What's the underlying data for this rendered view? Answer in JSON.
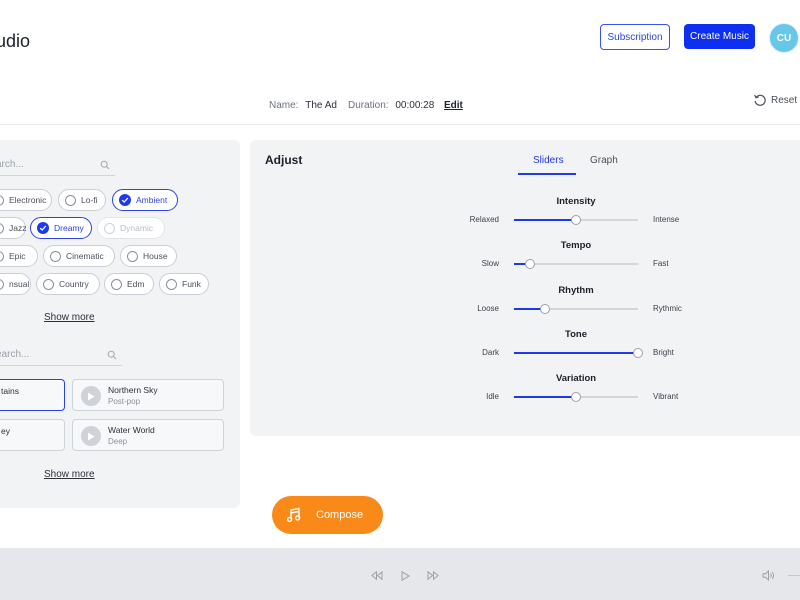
{
  "header": {
    "app_title": "udio",
    "subscription_label": "Subscription",
    "create_music_label": "Create Music",
    "avatar_initials": "CU"
  },
  "track_meta": {
    "name_label": "Name:",
    "name_value": "The Ad",
    "duration_label": "Duration:",
    "duration_value": "00:00:28",
    "edit_label": "Edit",
    "reset_label": "Reset"
  },
  "left_panel": {
    "genre_search_placeholder": "arch...",
    "genres": [
      {
        "label": "Electronic",
        "state": "unselected"
      },
      {
        "label": "Lo-fi",
        "state": "unselected"
      },
      {
        "label": "Ambient",
        "state": "selected"
      },
      {
        "label": "Jazz",
        "state": "unselected"
      },
      {
        "label": "Dreamy",
        "state": "selected"
      },
      {
        "label": "Dynamic",
        "state": "disabled"
      },
      {
        "label": "Epic",
        "state": "unselected"
      },
      {
        "label": "Cinematic",
        "state": "unselected"
      },
      {
        "label": "House",
        "state": "unselected"
      },
      {
        "label": "nsual",
        "state": "unselected"
      },
      {
        "label": "Country",
        "state": "unselected"
      },
      {
        "label": "Edm",
        "state": "unselected"
      },
      {
        "label": "Funk",
        "state": "unselected"
      }
    ],
    "genres_show_more": "Show more",
    "track_search_placeholder": "earch...",
    "tracks": [
      {
        "name": "tains",
        "genre": "",
        "selected": true
      },
      {
        "name": "Northern Sky",
        "genre": "Post-pop",
        "selected": false
      },
      {
        "name": "ey",
        "genre": "",
        "selected": false
      },
      {
        "name": "Water World",
        "genre": "Deep",
        "selected": false
      }
    ],
    "tracks_show_more": "Show more"
  },
  "adjust": {
    "title": "Adjust",
    "tabs": [
      {
        "label": "Sliders",
        "active": true
      },
      {
        "label": "Graph",
        "active": false
      }
    ],
    "sliders": [
      {
        "title": "Intensity",
        "left": "Relaxed",
        "right": "Intense",
        "value": 0.5
      },
      {
        "title": "Tempo",
        "left": "Slow",
        "right": "Fast",
        "value": 0.13
      },
      {
        "title": "Rhythm",
        "left": "Loose",
        "right": "Rythmic",
        "value": 0.25
      },
      {
        "title": "Tone",
        "left": "Dark",
        "right": "Bright",
        "value": 1.0
      },
      {
        "title": "Variation",
        "left": "Idle",
        "right": "Vibrant",
        "value": 0.5
      }
    ]
  },
  "compose_label": "Compose",
  "colors": {
    "accent": "#1f38e8",
    "compose": "#f98a19",
    "panel": "#f2f3f5",
    "avatar": "#67c7e8"
  },
  "icons": {
    "search": "search-icon",
    "reset": "reset-icon",
    "compose": "music-note-icon",
    "play": "play-icon",
    "rewind": "rewind-icon",
    "forward": "fast-forward-icon",
    "volume": "volume-icon"
  }
}
